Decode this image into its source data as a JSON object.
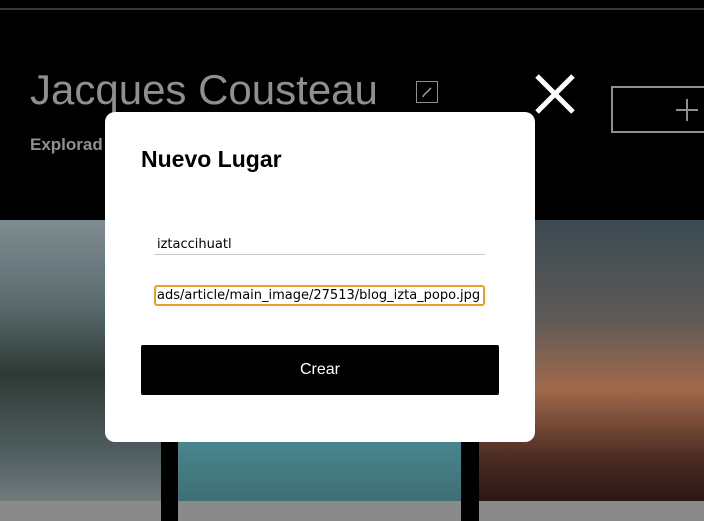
{
  "profile": {
    "name": "Jacques Cousteau",
    "about": "Explorad"
  },
  "modal": {
    "title": "Nuevo Lugar",
    "name_value": "iztaccihuatl",
    "link_value": "ads/article/main_image/27513/blog_izta_popo.jpg",
    "submit_label": "Crear"
  },
  "colors": {
    "focus_border": "#e5a02a",
    "dimmed_text": "#8f8f8f"
  },
  "icons": {
    "edit": "pencil-icon",
    "add": "plus-icon",
    "close": "close-icon"
  }
}
